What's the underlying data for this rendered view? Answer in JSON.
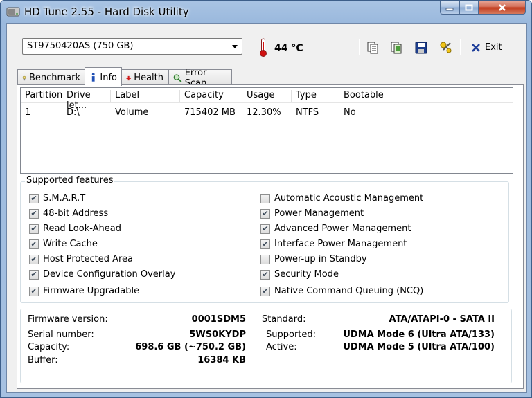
{
  "window": {
    "title": "HD Tune 2.55 - Hard Disk Utility"
  },
  "toolbar": {
    "drive": "ST9750420AS (750 GB)",
    "temperature": "44 °C",
    "exit_label": "Exit",
    "icons": [
      "copy-text-icon",
      "copy-screenshot-icon",
      "save-icon",
      "options-icon"
    ]
  },
  "tabs": [
    {
      "label": "Benchmark",
      "icon": "lightbulb-icon"
    },
    {
      "label": "Info",
      "icon": "info-icon",
      "active": true
    },
    {
      "label": "Health",
      "icon": "red-cross-icon"
    },
    {
      "label": "Error Scan",
      "icon": "magnifier-icon"
    }
  ],
  "partitions": {
    "headers": [
      "Partition",
      "Drive let...",
      "Label",
      "Capacity",
      "Usage",
      "Type",
      "Bootable"
    ],
    "rows": [
      [
        "1",
        "D:\\",
        "Volume",
        "715402 MB",
        "12.30%",
        "NTFS",
        "No"
      ]
    ]
  },
  "features": {
    "title": "Supported features",
    "left": [
      {
        "label": "S.M.A.R.T",
        "checked": true
      },
      {
        "label": "48-bit Address",
        "checked": true
      },
      {
        "label": "Read Look-Ahead",
        "checked": true
      },
      {
        "label": "Write Cache",
        "checked": true
      },
      {
        "label": "Host Protected Area",
        "checked": true
      },
      {
        "label": "Device Configuration Overlay",
        "checked": true
      },
      {
        "label": "Firmware Upgradable",
        "checked": true
      }
    ],
    "right": [
      {
        "label": "Automatic Acoustic Management",
        "checked": false
      },
      {
        "label": "Power Management",
        "checked": true
      },
      {
        "label": "Advanced Power Management",
        "checked": true
      },
      {
        "label": "Interface Power Management",
        "checked": true
      },
      {
        "label": "Power-up in Standby",
        "checked": false
      },
      {
        "label": "Security Mode",
        "checked": true
      },
      {
        "label": "Native Command Queuing (NCQ)",
        "checked": true
      }
    ]
  },
  "info": {
    "firmware_label": "Firmware version:",
    "firmware": "0001SDM5",
    "serial_label": "Serial number:",
    "serial": "5WS0KYDP",
    "capacity_label": "Capacity:",
    "capacity": "698.6 GB (~750.2 GB)",
    "buffer_label": "Buffer:",
    "buffer": "16384 KB",
    "standard_label": "Standard:",
    "standard": "ATA/ATAPI-0 - SATA II",
    "supported_label": "Supported:",
    "supported": "UDMA Mode 6 (Ultra ATA/133)",
    "active_label": "Active:",
    "active": "UDMA Mode 5 (Ultra ATA/100)"
  }
}
